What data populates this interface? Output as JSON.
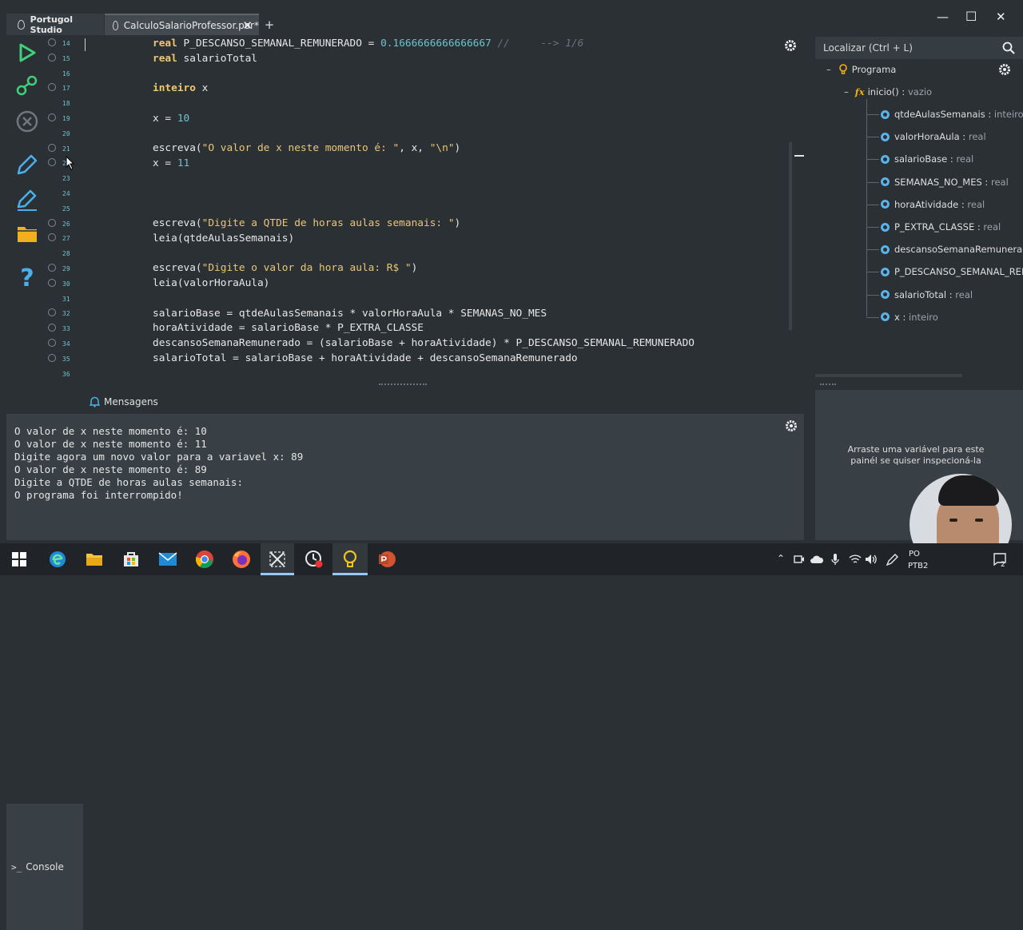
{
  "window": {
    "home_tab": "Portugol Studio",
    "file_tab": "CalculoSalarioProfessor.por*",
    "add_tab": "+",
    "minimize": "—",
    "maximize": "☐",
    "close": "✕"
  },
  "gutter": {
    "lines": [
      "14",
      "15",
      "16",
      "17",
      "18",
      "19",
      "20",
      "21",
      "22",
      "23",
      "24",
      "25",
      "26",
      "27",
      "28",
      "29",
      "30",
      "31",
      "32",
      "33",
      "34",
      "35",
      "36"
    ]
  },
  "editor": {
    "lines": [
      {
        "t": "var",
        "kw": "real",
        "rest": " P_DESCANSO_SEMANAL_REMUNERADO = ",
        "num": "0.1666666666666667",
        "cmt": " //     --> 1/6"
      },
      {
        "t": "plain",
        "kw": "real",
        "rest": " salarioTotal"
      },
      {
        "t": "blank"
      },
      {
        "t": "plain",
        "kw": "inteiro",
        "rest": " x"
      },
      {
        "t": "blank"
      },
      {
        "t": "assign",
        "pre": "x = ",
        "num": "10"
      },
      {
        "t": "blank"
      },
      {
        "t": "call",
        "pre": "escreva(",
        "str": "\"O valor de x neste momento é: \"",
        "post": ", x, ",
        "str2": "\"\\n\"",
        "end": ")"
      },
      {
        "t": "assign",
        "pre": "x = ",
        "num": "11"
      },
      {
        "t": "blank"
      },
      {
        "t": "blank"
      },
      {
        "t": "blank"
      },
      {
        "t": "call",
        "pre": "escreva(",
        "str": "\"Digite a QTDE de horas aulas semanais: \"",
        "post": "",
        "str2": "",
        "end": ")"
      },
      {
        "t": "text",
        "text": "leia(qtdeAulasSemanais)"
      },
      {
        "t": "blank"
      },
      {
        "t": "call",
        "pre": "escreva(",
        "str": "\"Digite o valor da hora aula: R$ \"",
        "post": "",
        "str2": "",
        "end": ")"
      },
      {
        "t": "text",
        "text": "leia(valorHoraAula)"
      },
      {
        "t": "blank"
      },
      {
        "t": "text",
        "text": "salarioBase = qtdeAulasSemanais * valorHoraAula * SEMANAS_NO_MES"
      },
      {
        "t": "text",
        "text": "horaAtividade = salarioBase * P_EXTRA_CLASSE"
      },
      {
        "t": "text",
        "text": "descansoSemanaRemunerado = (salarioBase + horaAtividade) * P_DESCANSO_SEMANAL_REMUNERADO"
      },
      {
        "t": "text",
        "text": "salarioTotal = salarioBase + horaAtividade + descansoSemanaRemunerado"
      }
    ]
  },
  "outline": {
    "search_placeholder": "Localizar (Ctrl + L)",
    "root": "Programa",
    "function": {
      "name": "inicio()",
      "sep": " : ",
      "type": "vazio"
    },
    "variables": [
      {
        "name": "qtdeAulasSemanais",
        "type": "inteiro"
      },
      {
        "name": "valorHoraAula",
        "type": "real"
      },
      {
        "name": "salarioBase",
        "type": "real"
      },
      {
        "name": "SEMANAS_NO_MES",
        "type": "real"
      },
      {
        "name": "horaAtividade",
        "type": "real"
      },
      {
        "name": "P_EXTRA_CLASSE",
        "type": "real"
      },
      {
        "name": "descansoSemanaRemunerado",
        "type": ""
      },
      {
        "name": "P_DESCANSO_SEMANAL_REM",
        "type": ""
      },
      {
        "name": "salarioTotal",
        "type": "real"
      },
      {
        "name": "x",
        "type": "inteiro"
      }
    ]
  },
  "console": {
    "tab_label": "Console",
    "messages_label": "Mensagens",
    "lines": [
      "O valor de x neste momento é: 10",
      "O valor de x neste momento é: 11",
      "Digite agora um novo valor para a variavel x: 89",
      "O valor de x neste momento é: 89",
      "Digite a QTDE de horas aulas semanais:",
      "O programa foi interrompido!"
    ]
  },
  "inspector": {
    "hint": "Arraste uma variável para este painél se quiser inspecioná-la"
  },
  "taskbar": {
    "lang_top": "PO",
    "lang_bottom": "PTB2",
    "notif_count": "2"
  },
  "colors": {
    "background": "#2b3034",
    "panel": "#394045",
    "keyword": "#f0c674",
    "number": "#6fc2ce",
    "var_dot": "#5ab3e8"
  }
}
